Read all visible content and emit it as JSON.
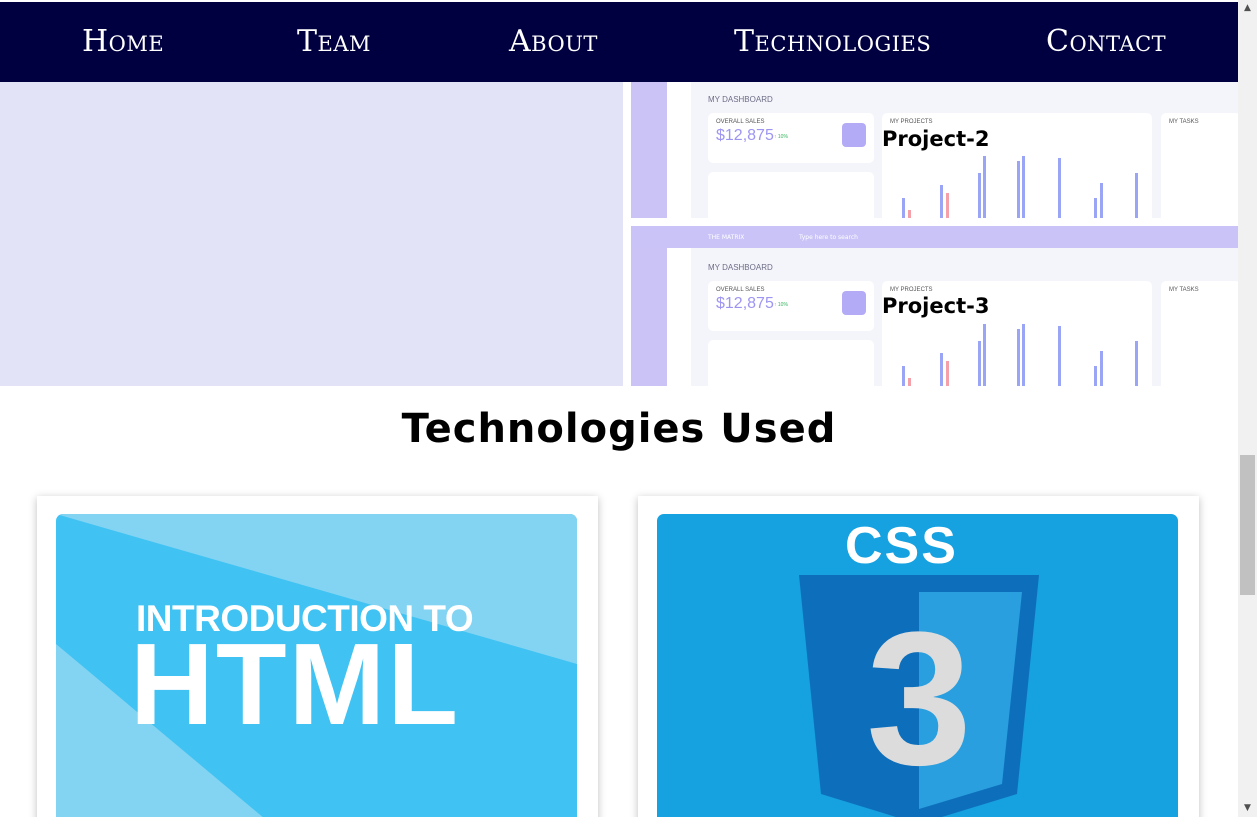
{
  "nav": {
    "items": [
      {
        "label": "Home"
      },
      {
        "label": "Team"
      },
      {
        "label": "About"
      },
      {
        "label": "Technologies"
      },
      {
        "label": "Contact"
      }
    ]
  },
  "projects": [
    {
      "label": "Project-2",
      "dashboard": {
        "title": "MY DASHBOARD",
        "sales_label": "OVERALL SALES",
        "sales_value": "$12,875",
        "sales_change": "↑ 10%",
        "projects_label": "MY PROJECTS",
        "tasks_label": "MY TASKS"
      }
    },
    {
      "label": "Project-3",
      "dashboard": {
        "app_name": "THE MATRIX",
        "search_placeholder": "Type here to search",
        "title": "MY DASHBOARD",
        "sales_label": "OVERALL SALES",
        "sales_value": "$12,875",
        "sales_change": "↑ 10%",
        "projects_label": "MY PROJECTS",
        "tasks_label": "MY TASKS"
      }
    }
  ],
  "technologies": {
    "title": "Technologies Used",
    "cards": [
      {
        "sub": "INTRODUCTION TO",
        "main": "HTML",
        "bg": "#40c3f2"
      },
      {
        "word": "CSS",
        "digit": "3",
        "bg": "#16a1e0"
      }
    ]
  },
  "colors": {
    "nav_bg": "#000040",
    "project_panel_bg": "#e3e3f7",
    "dashboard_accent": "#c9c3f7"
  }
}
